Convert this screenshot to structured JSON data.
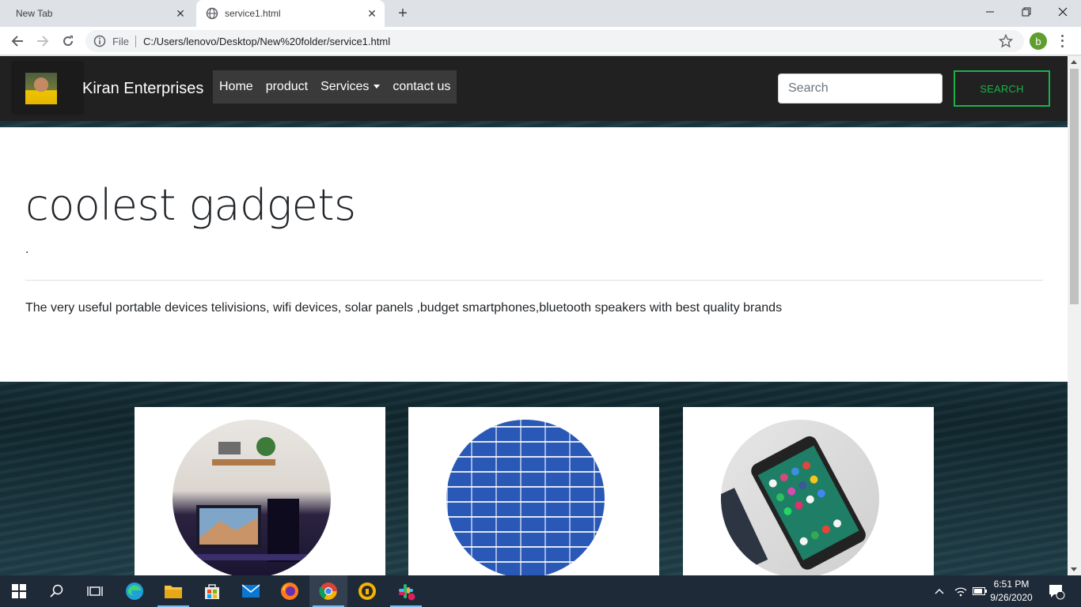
{
  "browser": {
    "tabs": [
      {
        "title": "New Tab",
        "active": false
      },
      {
        "title": "service1.html",
        "active": true
      }
    ],
    "new_tab_label": "+",
    "address": {
      "scheme_label": "File",
      "url": "C:/Users/lenovo/Desktop/New%20folder/service1.html"
    },
    "profile_initial": "b"
  },
  "site": {
    "brand_name": "Kiran Enterprises",
    "nav": [
      "Home",
      "product",
      "Services",
      "contact us"
    ],
    "search": {
      "placeholder": "Search",
      "button_label": "SEARCH"
    },
    "accent_color": "#18b348",
    "jumbotron": {
      "heading": "coolest gadgets",
      "subtext": ".",
      "lead": "The very useful portable devices telivisions, wifi devices, solar panels ,budget smartphones,bluetooth speakers with best quality brands"
    },
    "cards": [
      {
        "image": "gaming-desk-setup"
      },
      {
        "image": "solar-panel"
      },
      {
        "image": "smartphone"
      }
    ]
  },
  "taskbar": {
    "apps": [
      "start-icon",
      "search-icon",
      "task-view-icon",
      "edge-icon",
      "file-explorer-icon",
      "store-icon",
      "mail-icon",
      "firefox-icon",
      "chrome-icon",
      "vpn-icon",
      "slack-icon"
    ],
    "time": "6:51 PM",
    "date": "9/26/2020",
    "notification_count": "1"
  }
}
